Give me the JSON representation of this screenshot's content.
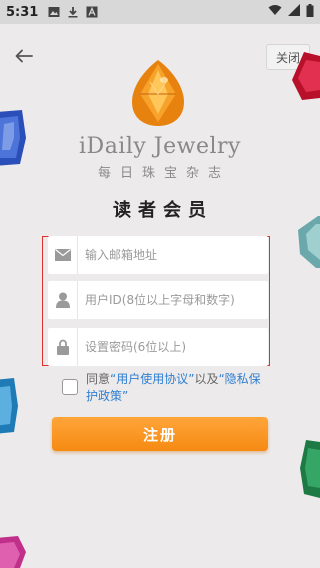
{
  "status_bar": {
    "time": "5:31",
    "left_icons": [
      "image-icon",
      "download-icon",
      "a-icon"
    ],
    "right_icons": [
      "wifi-icon",
      "signal-icon",
      "battery-icon"
    ]
  },
  "header": {
    "back_icon": "arrow-left-icon",
    "close_label": "关闭"
  },
  "brand": {
    "name_en": "iDaily Jewelry",
    "name_cn": "每日珠宝杂志"
  },
  "title": "读者会员",
  "form": {
    "email": {
      "placeholder": "输入邮箱地址",
      "value": "",
      "icon": "mail-icon"
    },
    "user_id": {
      "placeholder": "用户ID(8位以上字母和数字)",
      "value": "",
      "icon": "user-icon"
    },
    "password": {
      "placeholder": "设置密码(6位以上)",
      "value": "",
      "icon": "lock-icon"
    }
  },
  "agreement": {
    "prefix": "同意",
    "terms_link": "“用户使用协议”",
    "middle": "以及",
    "privacy_link": "“隐私保护政策”",
    "checked": false
  },
  "register_label": "注册",
  "colors": {
    "accent": "#f58a12",
    "link": "#2f7fd1",
    "highlight_border": "#e03030",
    "background": "#eceaea"
  }
}
